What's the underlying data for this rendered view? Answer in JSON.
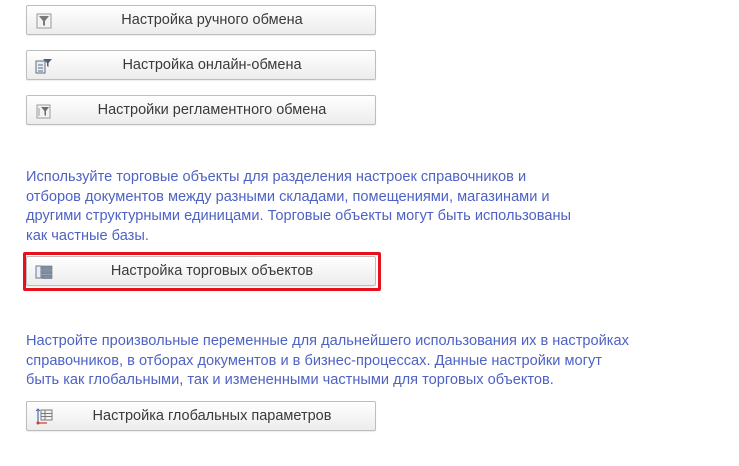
{
  "buttons": {
    "manual_exchange": "Настройка ручного обмена",
    "online_exchange": "Настройка онлайн-обмена",
    "scheduled_exchange": "Настройки регламентного обмена",
    "trade_objects": "Настройка торговых объектов",
    "global_params": "Настройка глобальных параметров"
  },
  "info": {
    "trade_objects": [
      "Используйте торговые объекты для разделения настроек справочников и",
      "отборов документов между разными складами, помещениями, магазинами и",
      "другими структурными единицами. Торговые объекты могут быть использованы",
      "как частные базы."
    ],
    "global_params": [
      "Настройте произвольные переменные для дальнейшего использования их в настройках",
      "справочников, в отборах документов и в бизнес-процессах. Данные настройки могут",
      "быть как глобальными, так и измененными частными для торговых объектов."
    ]
  },
  "icons": {
    "manual_exchange": "funnel-icon",
    "online_exchange": "document-funnel-icon",
    "scheduled_exchange": "scheduled-funnel-icon",
    "trade_objects": "stacked-list-icon",
    "global_params": "axis-table-icon"
  },
  "colors": {
    "info_text": "#4e62c4",
    "highlight": "#e8101a"
  }
}
